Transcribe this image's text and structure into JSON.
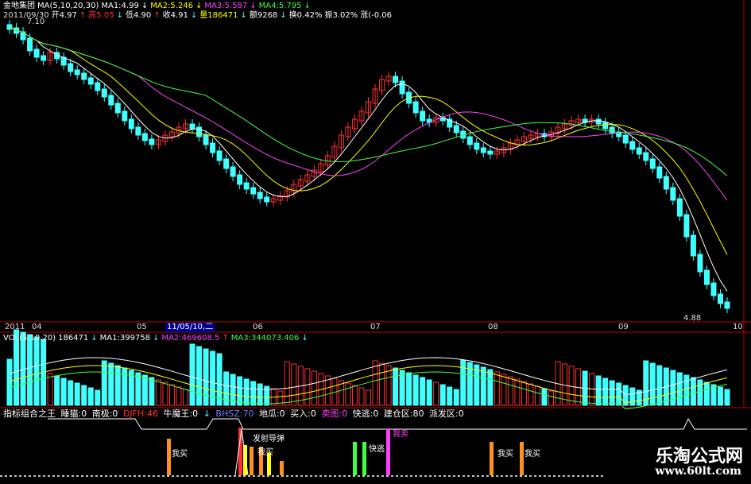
{
  "header": {
    "stock": "金地集团",
    "ma_label": "MA(5,10,20,30)",
    "ma1": "MA1:4.99",
    "ma1_arrow": "↓",
    "ma2": "MA2:5.246",
    "ma2_arrow": "↓",
    "ma3": "MA3:5.587",
    "ma3_arrow": "↓",
    "ma4": "MA4:5.795",
    "ma4_arrow": "↓"
  },
  "ohlc": {
    "date": "2011/09/30",
    "open": "开4.97",
    "open_arrow": "↑",
    "high": "高5.05",
    "high_arrow": "↓",
    "low": "低4.90",
    "low_arrow": "↑",
    "close": "收4.91",
    "close_arrow": "↓",
    "vol": "量186471",
    "vol_arrow": "↓",
    "amount": "额9268",
    "amount_arrow": "↓",
    "turnover": "换0.42%",
    "amplitude": "振3.02%",
    "change": "涨(-0.06"
  },
  "price_labels": {
    "high": "7.10",
    "low": "4.88"
  },
  "time_axis": {
    "year": "2011",
    "months": [
      "04",
      "05",
      "06",
      "07",
      "08",
      "09",
      "10"
    ],
    "cursor_date": "11/05/10,二"
  },
  "volume_header": {
    "label": "VOL(5,10,20)",
    "vol": "186471",
    "vol_arrow": "↓",
    "ma1": "MA1:399758",
    "ma1_arrow": "↓",
    "ma2": "MA2:469608.5",
    "ma2_arrow": "↑",
    "ma3": "MA3:344073.406",
    "ma3_arrow": "↓"
  },
  "indicator_header": {
    "title": "指标组合之王",
    "items": [
      "睡猫:0",
      "南极:0",
      "DJFH:46",
      "牛魔王:0",
      "↓",
      "BHSZ:70",
      "地瓜:0",
      "买入:0",
      "卖图:0",
      "快逃:0",
      "建仓区:80",
      "派发区:0"
    ]
  },
  "signals": {
    "buy": "我买",
    "buy2": "我买",
    "launch": "发射导弹",
    "buy_mid": "我买",
    "escape": "快逃",
    "sell": "我卖",
    "buy_right1": "我买",
    "buy_right2": "我买"
  },
  "watermark": {
    "name": "乐淘公式网",
    "url": "www.60lt.com"
  },
  "colors": {
    "up": "#ff3030",
    "down": "#40ffff",
    "ma1": "#ffffff",
    "ma2": "#ffff00",
    "ma3": "#ff40ff",
    "ma4": "#40ff40",
    "axis": "#c00000"
  },
  "chart_data": {
    "type": "candlestick",
    "series": [
      {
        "name": "MA1"
      },
      {
        "name": "MA2"
      },
      {
        "name": "MA3"
      },
      {
        "name": "MA4"
      }
    ],
    "price_range": [
      4.88,
      7.1
    ]
  }
}
